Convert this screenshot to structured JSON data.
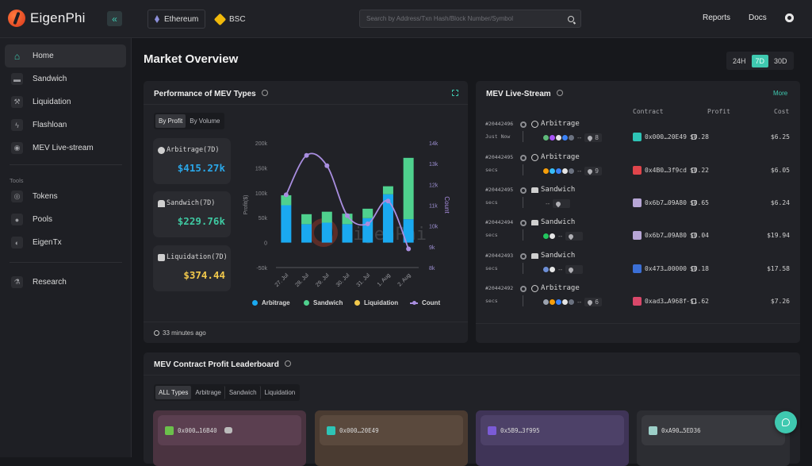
{
  "header": {
    "brand": "EigenPhi",
    "chains": [
      {
        "label": "Ethereum",
        "icon": "ethereum-icon",
        "active": true
      },
      {
        "label": "BSC",
        "icon": "bsc-icon",
        "active": false
      }
    ],
    "search_placeholder": "Search by Address/Txn Hash/Block Number/Symbol",
    "links": [
      "Reports",
      "Docs"
    ],
    "collapse_icon": "«"
  },
  "sidebar": {
    "items": [
      {
        "label": "Home",
        "icon": "home-icon",
        "glyph": "⌂",
        "active": true
      },
      {
        "label": "Sandwich",
        "icon": "sandwich-icon",
        "glyph": "▬"
      },
      {
        "label": "Liquidation",
        "icon": "liquidation-icon",
        "glyph": "⚒"
      },
      {
        "label": "Flashloan",
        "icon": "flashloan-icon",
        "glyph": "ϟ"
      },
      {
        "label": "MEV Live-stream",
        "icon": "livestream-icon",
        "glyph": "◉"
      }
    ],
    "tools_label": "Tools",
    "tools": [
      {
        "label": "Tokens",
        "icon": "tokens-icon",
        "glyph": "◎"
      },
      {
        "label": "Pools",
        "icon": "pools-icon",
        "glyph": "●"
      },
      {
        "label": "EigenTx",
        "icon": "eigentx-icon",
        "glyph": "◐"
      }
    ],
    "research": {
      "label": "Research",
      "icon": "research-icon",
      "glyph": "⚗"
    }
  },
  "main": {
    "title": "Market Overview",
    "ranges": [
      {
        "label": "24H",
        "active": false
      },
      {
        "label": "7D",
        "active": true
      },
      {
        "label": "30D",
        "active": false
      }
    ]
  },
  "performance": {
    "title": "Performance of MEV Types",
    "tabs": [
      {
        "label": "By Profit",
        "active": true
      },
      {
        "label": "By Volume",
        "active": false
      }
    ],
    "stats": [
      {
        "label": "Arbitrage(7D)",
        "value": "$415.27k",
        "color": "#2aa7e8"
      },
      {
        "label": "Sandwich(7D)",
        "value": "$229.76k",
        "color": "#3fc9a2"
      },
      {
        "label": "Liquidation(7D)",
        "value": "$374.44",
        "color": "#f2c94c"
      }
    ],
    "updated": "33 minutes ago",
    "watermark": "EigenPhi"
  },
  "chart_data": {
    "type": "bar",
    "stacked": true,
    "title": "",
    "categories": [
      "27. Jul",
      "28. Jul",
      "29. Jul",
      "30. Jul",
      "31. Jul",
      "1. Aug",
      "2. Aug"
    ],
    "series": [
      {
        "name": "Arbitrage",
        "type": "bar",
        "axis": "left",
        "color": "#1aa9f0",
        "values": [
          75000,
          37000,
          40000,
          37000,
          49000,
          97000,
          47000
        ]
      },
      {
        "name": "Sandwich",
        "type": "bar",
        "axis": "left",
        "color": "#4fd18e",
        "values": [
          20000,
          20000,
          22000,
          21000,
          19000,
          16000,
          123000
        ]
      },
      {
        "name": "Liquidation",
        "type": "bar",
        "axis": "left",
        "color": "#f2c94c",
        "values": [
          0,
          0,
          0,
          0,
          0,
          0,
          0
        ]
      },
      {
        "name": "Count",
        "type": "line",
        "axis": "right",
        "color": "#a98ee0",
        "values": [
          11500,
          13400,
          12900,
          10500,
          10100,
          11200,
          8900
        ]
      }
    ],
    "ylabel": "Profit($)",
    "y2label": "Count",
    "ylim": [
      -50000,
      200000
    ],
    "yticks": [
      "200k",
      "150k",
      "100k",
      "50k",
      "0",
      "-50k"
    ],
    "y2lim": [
      8000,
      14000
    ],
    "y2ticks": [
      "14k",
      "13k",
      "12k",
      "11k",
      "10k",
      "9k",
      "8k"
    ],
    "legend": [
      "Arbitrage",
      "Sandwich",
      "Liquidation",
      "Count"
    ],
    "legend_position": "bottom",
    "grid": false
  },
  "livestream": {
    "title": "MEV Live-Stream",
    "more": "More",
    "columns": [
      "Contract",
      "Profit",
      "Cost"
    ],
    "rows": [
      {
        "block": "#20442496",
        "time": "Just Now",
        "type": "Arbitrage",
        "tokens": [
          "#5fb97a",
          "#a855f7",
          "#e5e5e5",
          "#3b82f6",
          "#6b7280"
        ],
        "count": "8",
        "contract": "0x000…20E49",
        "avatar": "#2ec4b6",
        "profit": "$0.28",
        "cost": "$6.25"
      },
      {
        "block": "#20442495",
        "time": "secs",
        "type": "Arbitrage",
        "tokens": [
          "#f59e0b",
          "#38bdf8",
          "#3b82f6",
          "#e5e5e5",
          "#6b7280"
        ],
        "count": "9",
        "contract": "0x4B0…3f9cd",
        "avatar": "#e0454b",
        "profit": "$0.22",
        "cost": "$6.05"
      },
      {
        "block": "#20442495",
        "time": "secs",
        "type": "Sandwich",
        "tokens": [],
        "count": "",
        "contract": "0x6b7…09A80",
        "avatar": "#b7a6d6",
        "profit": "$0.65",
        "cost": "$6.24"
      },
      {
        "block": "#20442494",
        "time": "secs",
        "type": "Sandwich",
        "tokens": [
          "#22c55e",
          "#e5e5e5"
        ],
        "count": "",
        "contract": "0x6b7…09A80",
        "avatar": "#b7a6d6",
        "profit": "$0.04",
        "cost": "$19.94"
      },
      {
        "block": "#20442493",
        "time": "secs",
        "type": "Sandwich",
        "tokens": [
          "#6d8fd6",
          "#e5e5e5"
        ],
        "count": "",
        "contract": "0x473…00000",
        "avatar": "#3b6fd6",
        "profit": "$0.18",
        "cost": "$17.58"
      },
      {
        "block": "#20442492",
        "time": "secs",
        "type": "Arbitrage",
        "tokens": [
          "#9ca3af",
          "#f59e0b",
          "#3b82f6",
          "#e5e5e5",
          "#6b7280"
        ],
        "count": "6",
        "contract": "0xad3…A968f",
        "avatar": "#d9486a",
        "profit": "-$1.62",
        "cost": "$7.26"
      }
    ]
  },
  "leaderboard": {
    "title": "MEV Contract Profit Leaderboard",
    "tabs": [
      {
        "label": "ALL Types",
        "active": true
      },
      {
        "label": "Arbitrage",
        "active": false
      },
      {
        "label": "Sandwich",
        "active": false
      },
      {
        "label": "Liquidation",
        "active": false
      }
    ],
    "cards": [
      {
        "address": "0x000…16B40",
        "bg": "#4a3340",
        "inner": "#5b3f50",
        "avatar": "#6bc04b",
        "bot": true
      },
      {
        "address": "0x000…20E49",
        "bg": "#4a3b31",
        "inner": "#5a493d",
        "avatar": "#2ec4b6",
        "bot": false
      },
      {
        "address": "0x5B9…3f995",
        "bg": "#3f3457",
        "inner": "#4d4168",
        "avatar": "#7b5bd6",
        "bot": false
      },
      {
        "address": "0xA90…5ED36",
        "bg": "#2c2d32",
        "inner": "#38393e",
        "avatar": "#9ccfc8",
        "bot": false
      }
    ]
  }
}
